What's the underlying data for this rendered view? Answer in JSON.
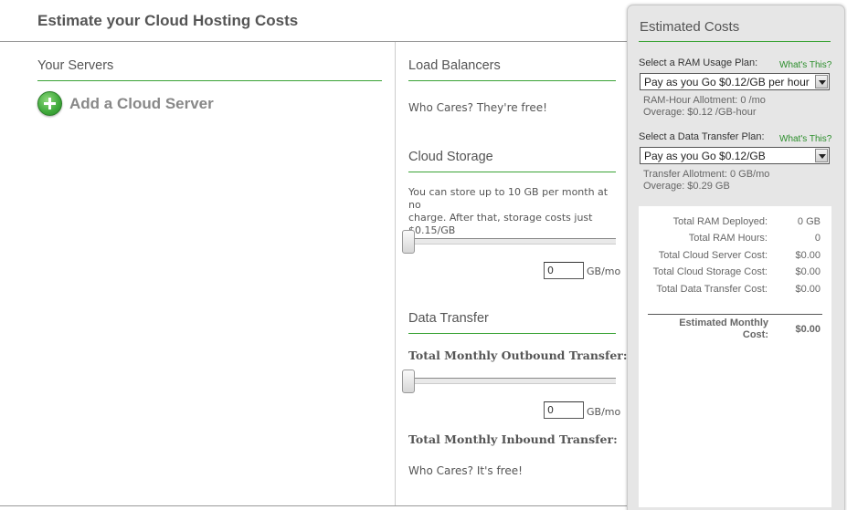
{
  "header": {
    "title": "Estimate your Cloud Hosting Costs"
  },
  "servers": {
    "heading": "Your Servers",
    "add_label": "Add a Cloud Server"
  },
  "load_balancers": {
    "heading": "Load Balancers",
    "text": "Who Cares? They're free!"
  },
  "cloud_storage": {
    "heading": "Cloud Storage",
    "description_line1": "You can store up to 10 GB per month at no",
    "description_line2": "charge. After that, storage costs just",
    "description_line3": "$0.15/GB",
    "slider_level": 0,
    "input_value": "0",
    "unit": "GB/mo"
  },
  "data_transfer": {
    "heading": "Data Transfer",
    "outbound_label": "Total Monthly Outbound Transfer:",
    "slider_level": 0,
    "input_value": "0",
    "unit": "GB/mo",
    "inbound_label": "Total Monthly Inbound Transfer:",
    "inbound_text": "Who Cares? It's free!"
  },
  "estimate_panel": {
    "title": "Estimated Costs",
    "ram_plan_label": "Select a RAM Usage Plan:",
    "ram_whats_this": "What's This?",
    "ram_plan_selected": "Pay as you Go $0.12/GB per hour",
    "ram_allotment": "RAM-Hour Allotment: 0 /mo",
    "ram_overage": "Overage: $0.12 /GB-hour",
    "transfer_plan_label": "Select a Data Transfer Plan:",
    "transfer_whats_this": "What's This?",
    "transfer_plan_selected": "Pay as you Go $0.12/GB",
    "transfer_allotment": "Transfer Allotment: 0 GB/mo",
    "transfer_overage": "Overage: $0.29 GB",
    "summary": [
      {
        "label": "Total RAM Deployed:",
        "value": "0 GB"
      },
      {
        "label": "Total RAM Hours:",
        "value": "0"
      },
      {
        "label": "Total Cloud Server Cost:",
        "value": "$0.00"
      },
      {
        "label": "Total Cloud Storage Cost:",
        "value": "$0.00"
      },
      {
        "label": "Total Data Transfer Cost:",
        "value": "$0.00"
      }
    ],
    "estimated_label_line1": "Estimated Monthly",
    "estimated_label_line2": "Cost:",
    "estimated_value": "$0.00"
  },
  "colors": {
    "accent": "#3aa335",
    "link": "#2b8e2b",
    "panel_bg": "#e6e6e6"
  },
  "icons": {
    "add_server": "plus-circle-icon",
    "select_arrow": "chevron-down-icon",
    "slider": "slider-handle"
  }
}
